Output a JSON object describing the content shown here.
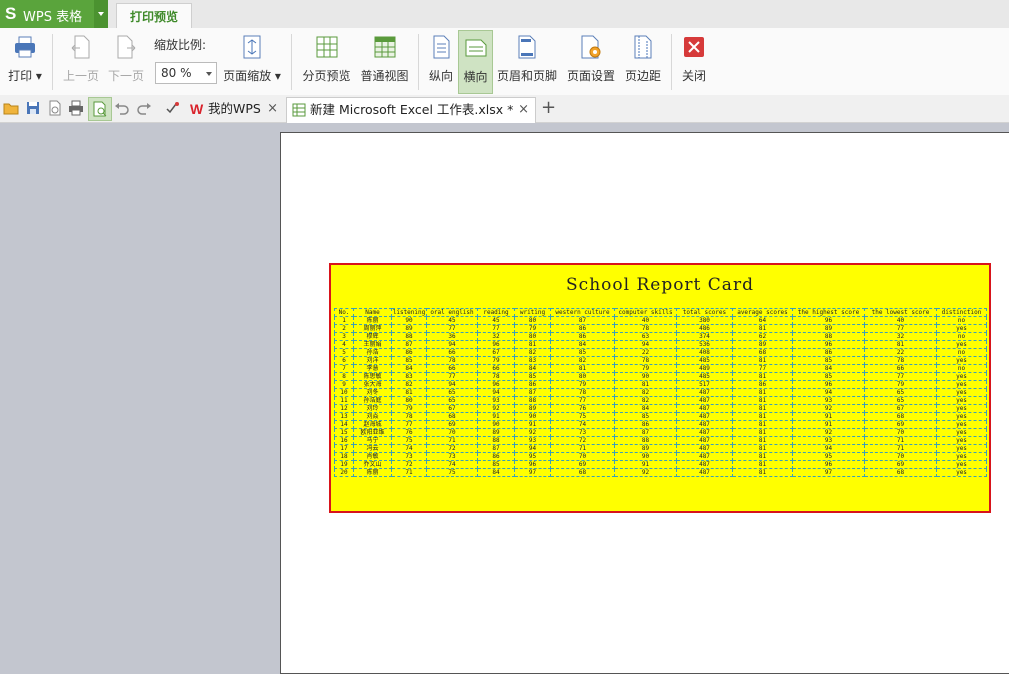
{
  "app": {
    "name": "WPS 表格",
    "ribbon_tab": "打印预览"
  },
  "ribbon": {
    "print": "打印",
    "prev_page": "上一页",
    "next_page": "下一页",
    "zoom_label": "缩放比例:",
    "zoom_value": "80 %",
    "page_zoom": "页面缩放",
    "page_break_preview": "分页预览",
    "normal_view": "普通视图",
    "portrait": "纵向",
    "landscape": "横向",
    "header_footer": "页眉和页脚",
    "page_setup": "页面设置",
    "margins": "页边距",
    "close": "关闭"
  },
  "tabs": {
    "my_wps": "我的WPS",
    "file": "新建 Microsoft Excel 工作表.xlsx *",
    "close_glyph": "×",
    "plus_glyph": "+"
  },
  "report": {
    "title": "School Report Card",
    "headers": [
      "No.",
      "Name",
      "listening",
      "oral english",
      "reading",
      "writing",
      "western culture",
      "computer skills",
      "total scores",
      "average scores",
      "the highest score",
      "the lowest score",
      "distinction"
    ],
    "rows": [
      [
        "1",
        "陈丽",
        "90",
        "45",
        "45",
        "80",
        "87",
        "40",
        "380",
        "64",
        "96",
        "40",
        "no"
      ],
      [
        "2",
        "周丽萍",
        "89",
        "77",
        "77",
        "79",
        "86",
        "78",
        "486",
        "81",
        "89",
        "77",
        "yes"
      ],
      [
        "3",
        "穆辉",
        "88",
        "36",
        "32",
        "80",
        "86",
        "63",
        "374",
        "62",
        "88",
        "32",
        "no"
      ],
      [
        "4",
        "王丽娟",
        "87",
        "94",
        "96",
        "81",
        "84",
        "94",
        "536",
        "89",
        "96",
        "81",
        "yes"
      ],
      [
        "5",
        "孙浩",
        "86",
        "66",
        "67",
        "82",
        "85",
        "22",
        "408",
        "68",
        "86",
        "22",
        "no"
      ],
      [
        "6",
        "刘洋",
        "85",
        "78",
        "79",
        "83",
        "82",
        "78",
        "485",
        "81",
        "85",
        "78",
        "yes"
      ],
      [
        "7",
        "李慧",
        "84",
        "66",
        "66",
        "84",
        "81",
        "79",
        "489",
        "77",
        "84",
        "66",
        "no"
      ],
      [
        "8",
        "陈思敏",
        "83",
        "77",
        "78",
        "85",
        "80",
        "90",
        "485",
        "81",
        "85",
        "77",
        "yes"
      ],
      [
        "9",
        "张大海",
        "82",
        "94",
        "96",
        "86",
        "79",
        "81",
        "517",
        "86",
        "96",
        "79",
        "yes"
      ],
      [
        "10",
        "刘冬",
        "81",
        "65",
        "94",
        "87",
        "78",
        "82",
        "487",
        "81",
        "94",
        "65",
        "yes"
      ],
      [
        "11",
        "孙浩庭",
        "80",
        "65",
        "93",
        "88",
        "77",
        "82",
        "487",
        "81",
        "93",
        "65",
        "yes"
      ],
      [
        "12",
        "刘玲",
        "79",
        "67",
        "92",
        "89",
        "76",
        "84",
        "487",
        "81",
        "92",
        "67",
        "yes"
      ],
      [
        "13",
        "刘焱",
        "78",
        "68",
        "91",
        "90",
        "75",
        "85",
        "487",
        "81",
        "91",
        "68",
        "yes"
      ],
      [
        "14",
        "赵海城",
        "77",
        "69",
        "90",
        "91",
        "74",
        "86",
        "487",
        "81",
        "91",
        "69",
        "yes"
      ],
      [
        "15",
        "欧阳亚维",
        "76",
        "70",
        "89",
        "92",
        "73",
        "87",
        "487",
        "81",
        "92",
        "70",
        "yes"
      ],
      [
        "16",
        "马宁",
        "75",
        "71",
        "88",
        "93",
        "72",
        "88",
        "487",
        "81",
        "93",
        "71",
        "yes"
      ],
      [
        "17",
        "冯云",
        "74",
        "72",
        "87",
        "94",
        "71",
        "89",
        "487",
        "81",
        "94",
        "71",
        "yes"
      ],
      [
        "18",
        "肖敏",
        "73",
        "73",
        "86",
        "95",
        "70",
        "90",
        "487",
        "81",
        "95",
        "70",
        "yes"
      ],
      [
        "19",
        "乔文山",
        "72",
        "74",
        "85",
        "96",
        "69",
        "91",
        "487",
        "81",
        "96",
        "69",
        "yes"
      ],
      [
        "20",
        "陈丽",
        "71",
        "75",
        "84",
        "97",
        "68",
        "92",
        "487",
        "81",
        "97",
        "68",
        "yes"
      ]
    ]
  }
}
